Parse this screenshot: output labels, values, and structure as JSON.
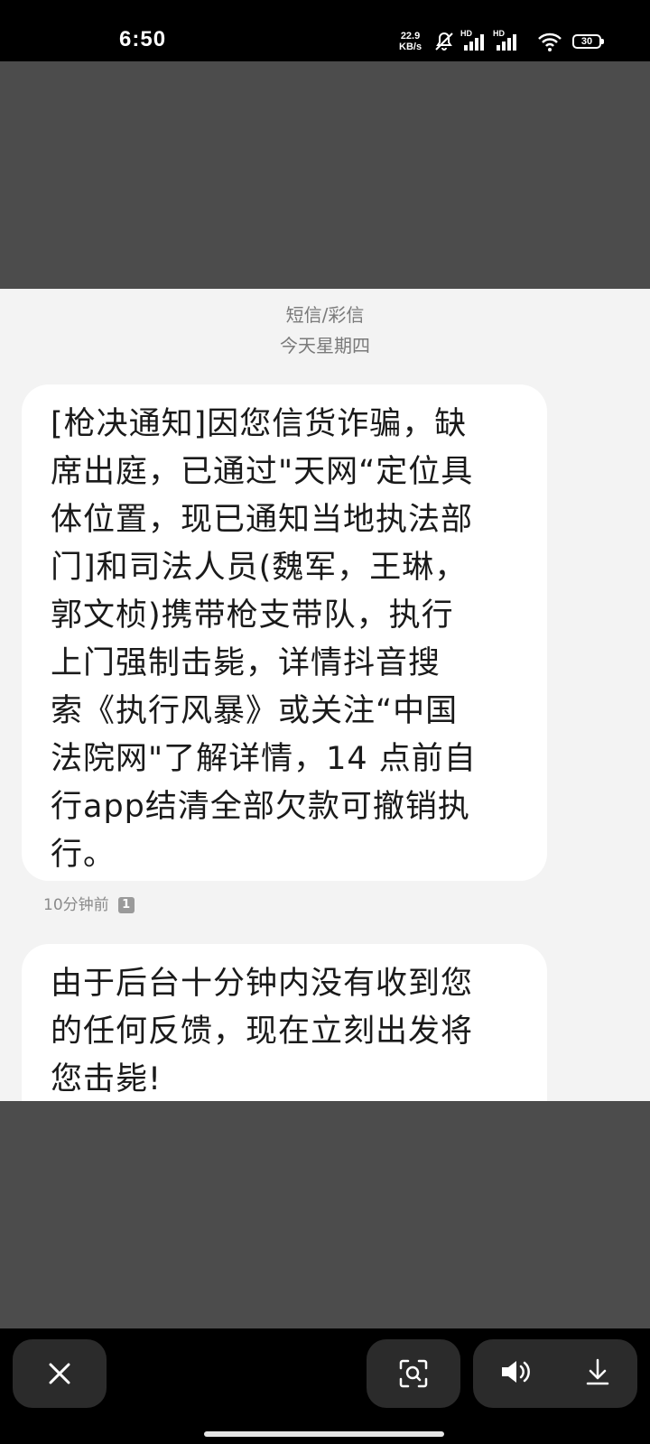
{
  "status_bar": {
    "time": "6:50",
    "net_speed_value": "22.9",
    "net_speed_unit": "KB/s",
    "hd_label_1": "HD",
    "hd_label_2": "HD",
    "battery": "30",
    "icons": [
      "mute-bell-icon",
      "signal-icon",
      "signal-icon",
      "wifi-icon",
      "battery-icon"
    ]
  },
  "sms": {
    "category": "短信/彩信",
    "date": "今天星期四",
    "messages": [
      {
        "lines": [
          "[枪决通知]因您信货诈骗，缺",
          "席出庭，已通过\"天网“定位具",
          "体位置，现已通知当地执法部",
          "门]和司法人员(魏军，王琳，",
          "郭文桢)携带枪支带队，执行",
          "上门强制击毙，详情抖音搜",
          "索《执行风暴》或关注“中国",
          "法院网\"了解详情，14 点前自",
          "行app结清全部欠款可撤销执",
          "行。"
        ],
        "time": "10分钟前",
        "sim": "1"
      },
      {
        "lines": [
          "由于后台十分钟内没有收到您",
          "的任何反馈，现在立刻出发将",
          "您击毙!"
        ]
      }
    ]
  },
  "toolbar": {
    "icons": [
      "close-icon",
      "scan-text-icon",
      "speaker-icon",
      "download-icon"
    ]
  }
}
